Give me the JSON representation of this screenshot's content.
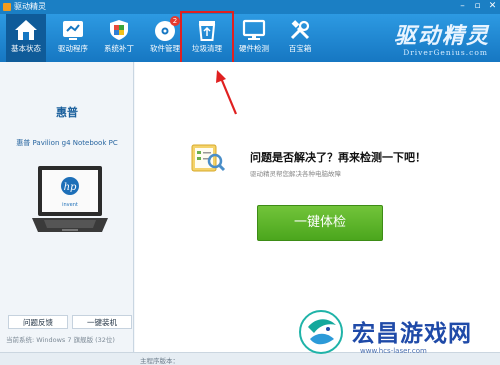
{
  "window": {
    "title": "驱动精灵"
  },
  "toolbar": {
    "items": [
      {
        "label": "基本状态",
        "icon": "home-icon"
      },
      {
        "label": "驱动程序",
        "icon": "driver-icon"
      },
      {
        "label": "系统补丁",
        "icon": "shield-icon"
      },
      {
        "label": "软件管理",
        "icon": "disc-icon",
        "badge": "2"
      },
      {
        "label": "垃圾清理",
        "icon": "recycle-bin-icon"
      },
      {
        "label": "硬件检测",
        "icon": "monitor-icon"
      },
      {
        "label": "百宝箱",
        "icon": "tools-icon"
      }
    ],
    "brand": {
      "name": "驱动精灵",
      "url": "DriverGenius.com"
    }
  },
  "left": {
    "brand": "惠普",
    "model": "惠普 Pavilion g4 Notebook PC",
    "laptop_logo": "hp",
    "laptop_caption": "invent",
    "feedback_button": "问题反馈",
    "install_button": "一键装机",
    "system_label": "当前系统:",
    "system_value": "Windows 7 旗舰版 (32位)"
  },
  "main": {
    "question": "问题是否解决了？再来检测一下吧！",
    "subtitle": "驱动精灵帮您解决各种电脑故障",
    "check_button": "一键体检"
  },
  "status": {
    "left": "主程序版本："
  },
  "watermark": {
    "text": "宏昌游戏网",
    "url": "www.hcs-laser.com"
  },
  "colors": {
    "titlebar": "#1b7fc4",
    "accent_green": "#5cb52a",
    "highlight_red": "#e02020"
  }
}
